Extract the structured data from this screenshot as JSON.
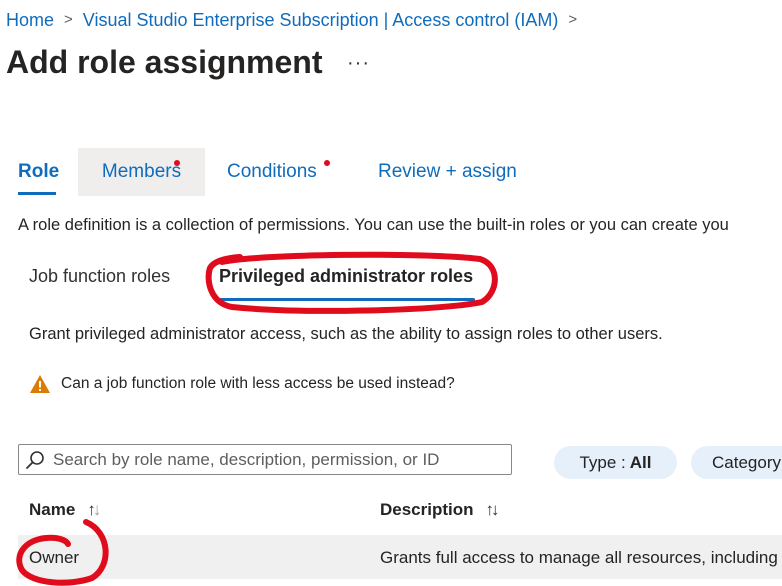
{
  "breadcrumb": {
    "items": [
      "Home",
      "Visual Studio Enterprise Subscription | Access control (IAM)"
    ],
    "separator": ">"
  },
  "page": {
    "title": "Add role assignment",
    "more": "···"
  },
  "wizard_tabs": [
    {
      "label": "Role",
      "active": true,
      "unfilled_indicator": false
    },
    {
      "label": "Members",
      "active": false,
      "unfilled_indicator": true
    },
    {
      "label": "Conditions",
      "active": false,
      "unfilled_indicator": true
    },
    {
      "label": "Review + assign",
      "active": false,
      "unfilled_indicator": false
    }
  ],
  "intro_text": "A role definition is a collection of permissions. You can use the built-in roles or you can create you",
  "role_tabs": [
    {
      "label": "Job function roles",
      "selected": false
    },
    {
      "label": "Privileged administrator roles",
      "selected": true
    }
  ],
  "grant_text": "Grant privileged administrator access, such as the ability to assign roles to other users.",
  "warning": {
    "icon": "warning-triangle-icon",
    "text": "Can a job function role with less access be used instead?"
  },
  "search": {
    "placeholder": "Search by role name, description, permission, or ID",
    "value": ""
  },
  "filters": {
    "type": {
      "label": "Type :",
      "value": "All"
    },
    "category": {
      "label": "Category"
    }
  },
  "table": {
    "columns": [
      {
        "label": "Name",
        "sort_icon": "↑↓"
      },
      {
        "label": "Description",
        "sort_icon": "↑↓"
      }
    ],
    "rows": [
      {
        "name": "Owner",
        "description": "Grants full access to manage all resources, including"
      }
    ]
  },
  "colors": {
    "accent": "#0f6cbd",
    "indicator_dot": "#e00b1c",
    "annotation": "#e00b1c",
    "warning": "#da7b06",
    "pill_bg": "#e6f0fb",
    "selected_row_bg": "#f0f0f0"
  }
}
